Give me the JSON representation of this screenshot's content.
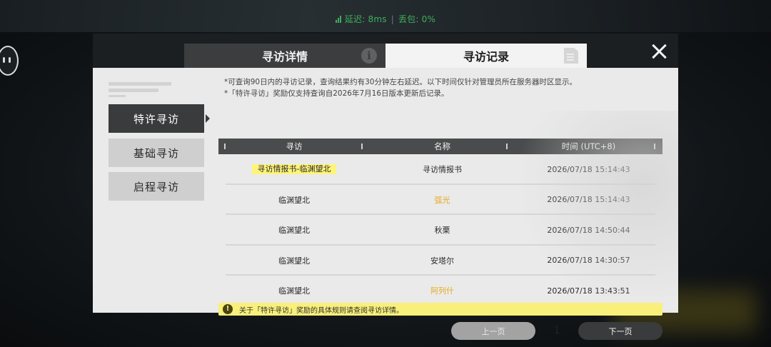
{
  "network": {
    "latency": "延迟: 8ms",
    "packet_loss": "丢包: 0%"
  },
  "tabs": {
    "details": "寻访详情",
    "records": "寻访记录"
  },
  "sidebar": {
    "items": [
      {
        "label": "特许寻访"
      },
      {
        "label": "基础寻访"
      },
      {
        "label": "启程寻访"
      }
    ]
  },
  "notes": {
    "line1": "*可查询90日内的寻访记录，查询结果约有30分钟左右延迟。以下时间仅针对管理员所在服务器时区显示。",
    "line2": "*「特许寻访」奖励仅支持查询自2026年7月16日版本更新后记录。"
  },
  "table": {
    "headers": [
      "寻访",
      "名称",
      "时间 (UTC+8)"
    ],
    "rows": [
      {
        "pool": "寻访情报书-临渊望北",
        "name": "寻访情报书",
        "time": "2026/07/18 15:14:43"
      },
      {
        "pool": "临渊望北",
        "name": "弧光",
        "time": "2026/07/18 15:14:43"
      },
      {
        "pool": "临渊望北",
        "name": "秋栗",
        "time": "2026/07/18 14:50:44"
      },
      {
        "pool": "临渊望北",
        "name": "安塔尔",
        "time": "2026/07/18 14:30:57"
      },
      {
        "pool": "临渊望北",
        "name": "阿列什",
        "time": "2026/07/18 13:43:51"
      }
    ]
  },
  "tip": {
    "icon": "!",
    "text": "关于「特许寻访」奖励的具体规则请查阅寻访详情。"
  },
  "pager": {
    "prev": "上一页",
    "page": "1",
    "next": "下一页"
  },
  "icons": {
    "info": "i"
  },
  "colors": {
    "highlight": "#fff47a",
    "rare_name": "#e6a81e",
    "network_ok": "#3fae5a"
  }
}
